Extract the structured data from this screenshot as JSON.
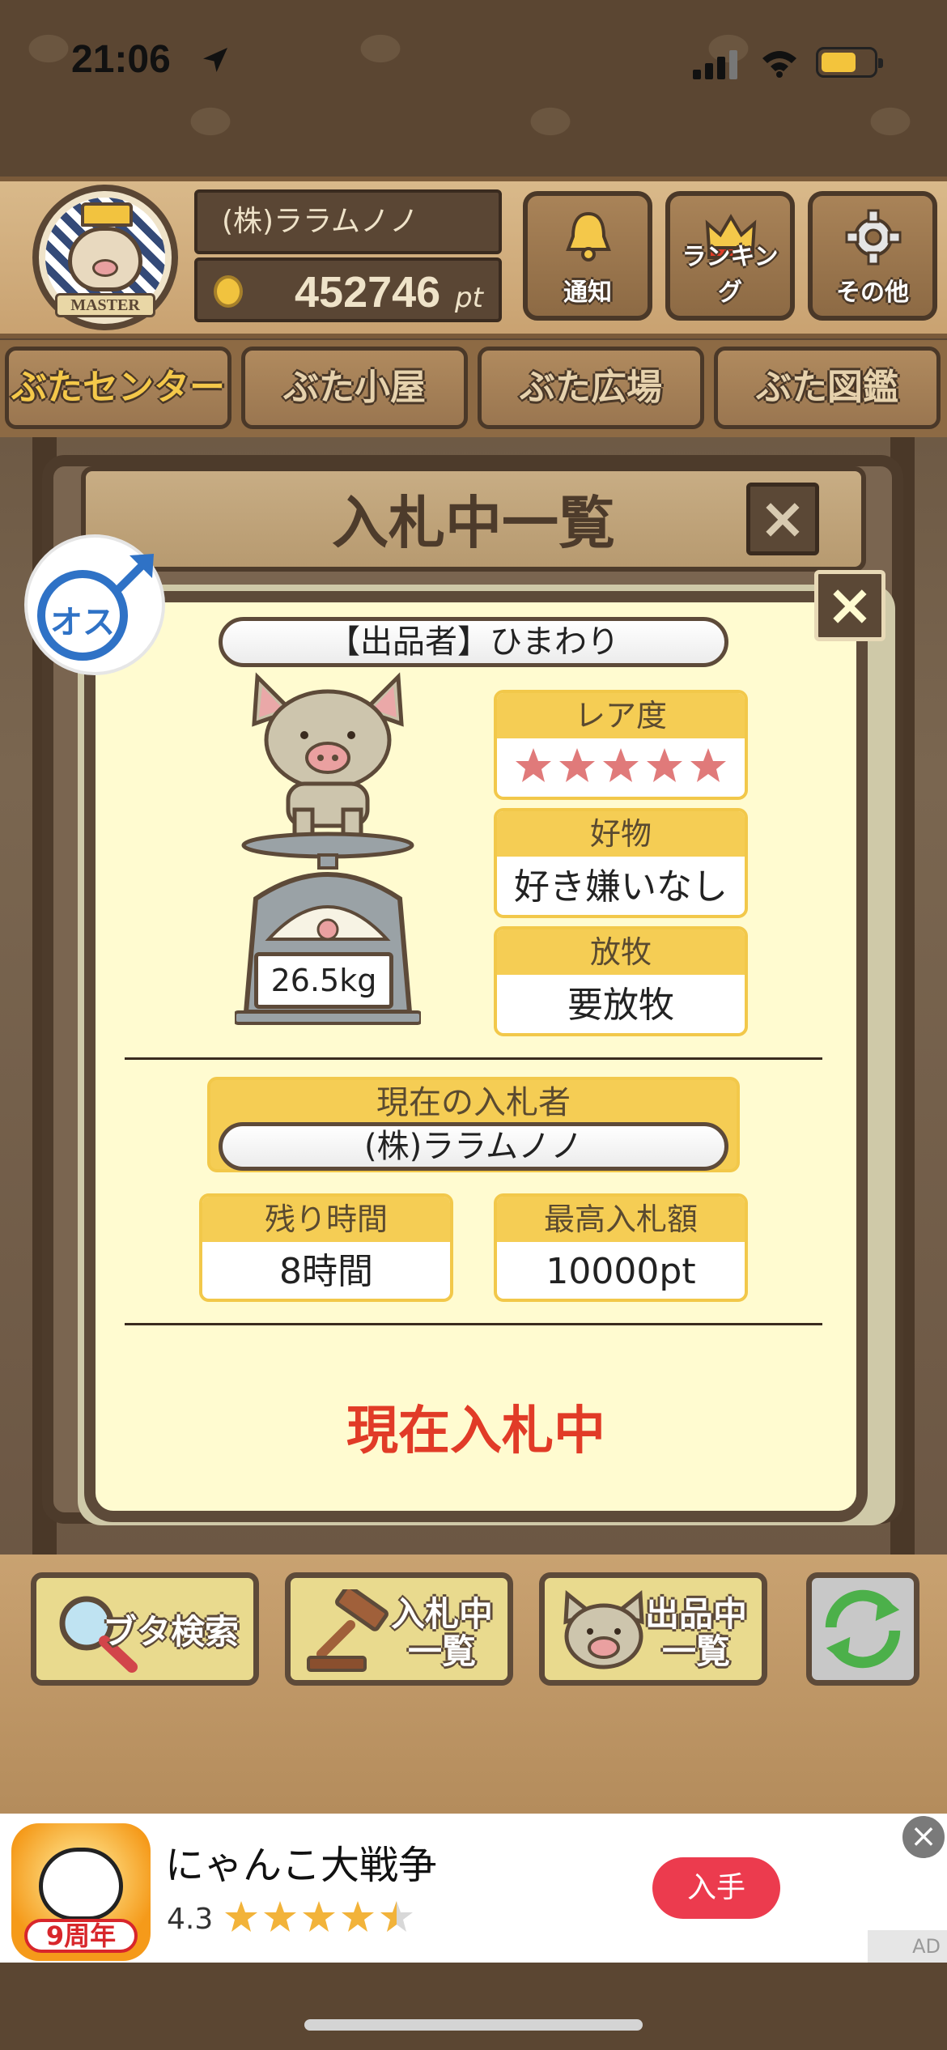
{
  "status_bar": {
    "time": "21:06"
  },
  "header": {
    "master_label": "MASTER",
    "company": "(株)ララムノノ",
    "points": "452746",
    "points_unit": "pt",
    "buttons": [
      {
        "label": "通知",
        "icon": "bell-icon"
      },
      {
        "label": "ランキング",
        "icon": "crown-icon"
      },
      {
        "label": "その他",
        "icon": "gear-icon"
      }
    ]
  },
  "nav_tabs": [
    {
      "label": "ぶたセンター",
      "active": true
    },
    {
      "label": "ぶた小屋",
      "active": false
    },
    {
      "label": "ぶた広場",
      "active": false
    },
    {
      "label": "ぶた図鑑",
      "active": false
    }
  ],
  "dialog": {
    "title": "入札中一覧",
    "card": {
      "gender": "オス",
      "seller": "【出品者】ひまわり",
      "weight": "26.5kg",
      "rarity_label": "レア度",
      "rarity_stars": 5,
      "favorite_label": "好物",
      "favorite_value": "好き嫌いなし",
      "grazing_label": "放牧",
      "grazing_value": "要放牧",
      "current_bidder_label": "現在の入札者",
      "current_bidder": "(株)ララムノノ",
      "time_left_label": "残り時間",
      "time_left": "8時間",
      "top_bid_label": "最高入札額",
      "top_bid": "10000pt",
      "status": "現在入札中"
    }
  },
  "toolbar": {
    "search_label": "ブタ検索",
    "bidding_label_1": "入札中",
    "bidding_label_2": "一覧",
    "listing_label_1": "出品中",
    "listing_label_2": "一覧"
  },
  "ad": {
    "app_name": "にゃんこ大戦争",
    "anniversary": "9周年",
    "rating": "4.3",
    "rating_stars": 4.3,
    "cta": "入手",
    "badge": "AD"
  },
  "colors": {
    "wood_dark": "#5d4a39",
    "card_bg": "#fffbd0",
    "label_yellow": "#f5cd54",
    "status_red": "#e13b27",
    "male_blue": "#2f72c6"
  }
}
